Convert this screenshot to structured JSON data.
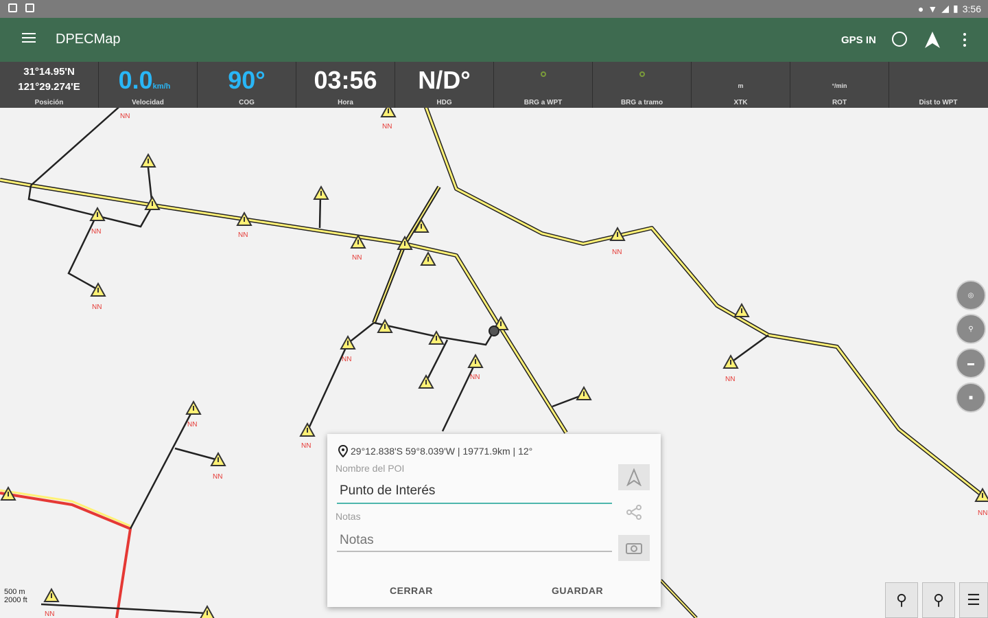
{
  "status_bar": {
    "time": "3:56"
  },
  "app_bar": {
    "title": "DPECMap",
    "gps_label": "GPS IN"
  },
  "info_bar": {
    "position": {
      "lat": "31°14.95'N",
      "lon": "121°29.274'E",
      "label": "Posición"
    },
    "speed": {
      "value": "0.0",
      "unit": "km/h",
      "label": "Velocidad"
    },
    "cog": {
      "value": "90°",
      "label": "COG"
    },
    "time": {
      "value": "03:56",
      "label": "Hora"
    },
    "hdg": {
      "value": "N/D°",
      "label": "HDG"
    },
    "brg_wpt": {
      "label": "BRG a WPT"
    },
    "brg_track": {
      "label": "BRG a tramo"
    },
    "xtk": {
      "unit": "m",
      "label": "XTK"
    },
    "rot": {
      "unit": "°/min",
      "label": "ROT"
    },
    "dist_wpt": {
      "label": "Dist to WPT"
    }
  },
  "map": {
    "marker_label": "NN",
    "scale_metric": "500 m",
    "scale_imperial": "2000 ft"
  },
  "dialog": {
    "coords": "29°12.838'S 59°8.039'W | 19771.9km | 12°",
    "name_label": "Nombre del POI",
    "name_value": "Punto de Interés",
    "notes_label": "Notas",
    "notes_placeholder": "Notas",
    "close_button": "CERRAR",
    "save_button": "GUARDAR"
  },
  "colors": {
    "app_bar": "#3e6b50",
    "info_bar": "#474747",
    "speed_accent": "#29b6f6",
    "route": "#fff176",
    "alert_route": "#e53935"
  }
}
